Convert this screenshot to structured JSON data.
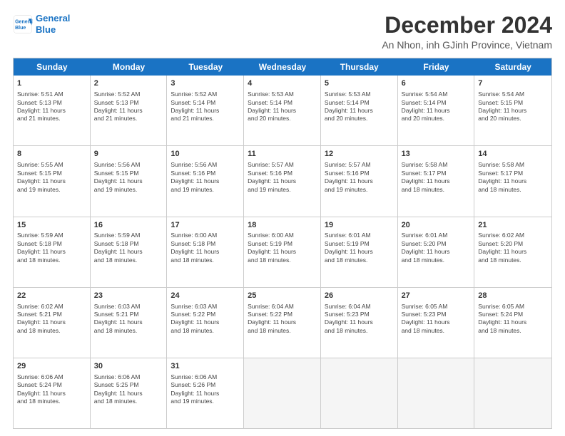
{
  "header": {
    "logo_line1": "General",
    "logo_line2": "Blue",
    "month": "December 2024",
    "location": "An Nhon, inh GJinh Province, Vietnam"
  },
  "weekdays": [
    "Sunday",
    "Monday",
    "Tuesday",
    "Wednesday",
    "Thursday",
    "Friday",
    "Saturday"
  ],
  "rows": [
    [
      {
        "day": "1",
        "lines": [
          "Sunrise: 5:51 AM",
          "Sunset: 5:13 PM",
          "Daylight: 11 hours",
          "and 21 minutes."
        ]
      },
      {
        "day": "2",
        "lines": [
          "Sunrise: 5:52 AM",
          "Sunset: 5:13 PM",
          "Daylight: 11 hours",
          "and 21 minutes."
        ]
      },
      {
        "day": "3",
        "lines": [
          "Sunrise: 5:52 AM",
          "Sunset: 5:14 PM",
          "Daylight: 11 hours",
          "and 21 minutes."
        ]
      },
      {
        "day": "4",
        "lines": [
          "Sunrise: 5:53 AM",
          "Sunset: 5:14 PM",
          "Daylight: 11 hours",
          "and 20 minutes."
        ]
      },
      {
        "day": "5",
        "lines": [
          "Sunrise: 5:53 AM",
          "Sunset: 5:14 PM",
          "Daylight: 11 hours",
          "and 20 minutes."
        ]
      },
      {
        "day": "6",
        "lines": [
          "Sunrise: 5:54 AM",
          "Sunset: 5:14 PM",
          "Daylight: 11 hours",
          "and 20 minutes."
        ]
      },
      {
        "day": "7",
        "lines": [
          "Sunrise: 5:54 AM",
          "Sunset: 5:15 PM",
          "Daylight: 11 hours",
          "and 20 minutes."
        ]
      }
    ],
    [
      {
        "day": "8",
        "lines": [
          "Sunrise: 5:55 AM",
          "Sunset: 5:15 PM",
          "Daylight: 11 hours",
          "and 19 minutes."
        ]
      },
      {
        "day": "9",
        "lines": [
          "Sunrise: 5:56 AM",
          "Sunset: 5:15 PM",
          "Daylight: 11 hours",
          "and 19 minutes."
        ]
      },
      {
        "day": "10",
        "lines": [
          "Sunrise: 5:56 AM",
          "Sunset: 5:16 PM",
          "Daylight: 11 hours",
          "and 19 minutes."
        ]
      },
      {
        "day": "11",
        "lines": [
          "Sunrise: 5:57 AM",
          "Sunset: 5:16 PM",
          "Daylight: 11 hours",
          "and 19 minutes."
        ]
      },
      {
        "day": "12",
        "lines": [
          "Sunrise: 5:57 AM",
          "Sunset: 5:16 PM",
          "Daylight: 11 hours",
          "and 19 minutes."
        ]
      },
      {
        "day": "13",
        "lines": [
          "Sunrise: 5:58 AM",
          "Sunset: 5:17 PM",
          "Daylight: 11 hours",
          "and 18 minutes."
        ]
      },
      {
        "day": "14",
        "lines": [
          "Sunrise: 5:58 AM",
          "Sunset: 5:17 PM",
          "Daylight: 11 hours",
          "and 18 minutes."
        ]
      }
    ],
    [
      {
        "day": "15",
        "lines": [
          "Sunrise: 5:59 AM",
          "Sunset: 5:18 PM",
          "Daylight: 11 hours",
          "and 18 minutes."
        ]
      },
      {
        "day": "16",
        "lines": [
          "Sunrise: 5:59 AM",
          "Sunset: 5:18 PM",
          "Daylight: 11 hours",
          "and 18 minutes."
        ]
      },
      {
        "day": "17",
        "lines": [
          "Sunrise: 6:00 AM",
          "Sunset: 5:18 PM",
          "Daylight: 11 hours",
          "and 18 minutes."
        ]
      },
      {
        "day": "18",
        "lines": [
          "Sunrise: 6:00 AM",
          "Sunset: 5:19 PM",
          "Daylight: 11 hours",
          "and 18 minutes."
        ]
      },
      {
        "day": "19",
        "lines": [
          "Sunrise: 6:01 AM",
          "Sunset: 5:19 PM",
          "Daylight: 11 hours",
          "and 18 minutes."
        ]
      },
      {
        "day": "20",
        "lines": [
          "Sunrise: 6:01 AM",
          "Sunset: 5:20 PM",
          "Daylight: 11 hours",
          "and 18 minutes."
        ]
      },
      {
        "day": "21",
        "lines": [
          "Sunrise: 6:02 AM",
          "Sunset: 5:20 PM",
          "Daylight: 11 hours",
          "and 18 minutes."
        ]
      }
    ],
    [
      {
        "day": "22",
        "lines": [
          "Sunrise: 6:02 AM",
          "Sunset: 5:21 PM",
          "Daylight: 11 hours",
          "and 18 minutes."
        ]
      },
      {
        "day": "23",
        "lines": [
          "Sunrise: 6:03 AM",
          "Sunset: 5:21 PM",
          "Daylight: 11 hours",
          "and 18 minutes."
        ]
      },
      {
        "day": "24",
        "lines": [
          "Sunrise: 6:03 AM",
          "Sunset: 5:22 PM",
          "Daylight: 11 hours",
          "and 18 minutes."
        ]
      },
      {
        "day": "25",
        "lines": [
          "Sunrise: 6:04 AM",
          "Sunset: 5:22 PM",
          "Daylight: 11 hours",
          "and 18 minutes."
        ]
      },
      {
        "day": "26",
        "lines": [
          "Sunrise: 6:04 AM",
          "Sunset: 5:23 PM",
          "Daylight: 11 hours",
          "and 18 minutes."
        ]
      },
      {
        "day": "27",
        "lines": [
          "Sunrise: 6:05 AM",
          "Sunset: 5:23 PM",
          "Daylight: 11 hours",
          "and 18 minutes."
        ]
      },
      {
        "day": "28",
        "lines": [
          "Sunrise: 6:05 AM",
          "Sunset: 5:24 PM",
          "Daylight: 11 hours",
          "and 18 minutes."
        ]
      }
    ],
    [
      {
        "day": "29",
        "lines": [
          "Sunrise: 6:06 AM",
          "Sunset: 5:24 PM",
          "Daylight: 11 hours",
          "and 18 minutes."
        ]
      },
      {
        "day": "30",
        "lines": [
          "Sunrise: 6:06 AM",
          "Sunset: 5:25 PM",
          "Daylight: 11 hours",
          "and 18 minutes."
        ]
      },
      {
        "day": "31",
        "lines": [
          "Sunrise: 6:06 AM",
          "Sunset: 5:26 PM",
          "Daylight: 11 hours",
          "and 19 minutes."
        ]
      },
      {
        "day": "",
        "lines": []
      },
      {
        "day": "",
        "lines": []
      },
      {
        "day": "",
        "lines": []
      },
      {
        "day": "",
        "lines": []
      }
    ]
  ]
}
